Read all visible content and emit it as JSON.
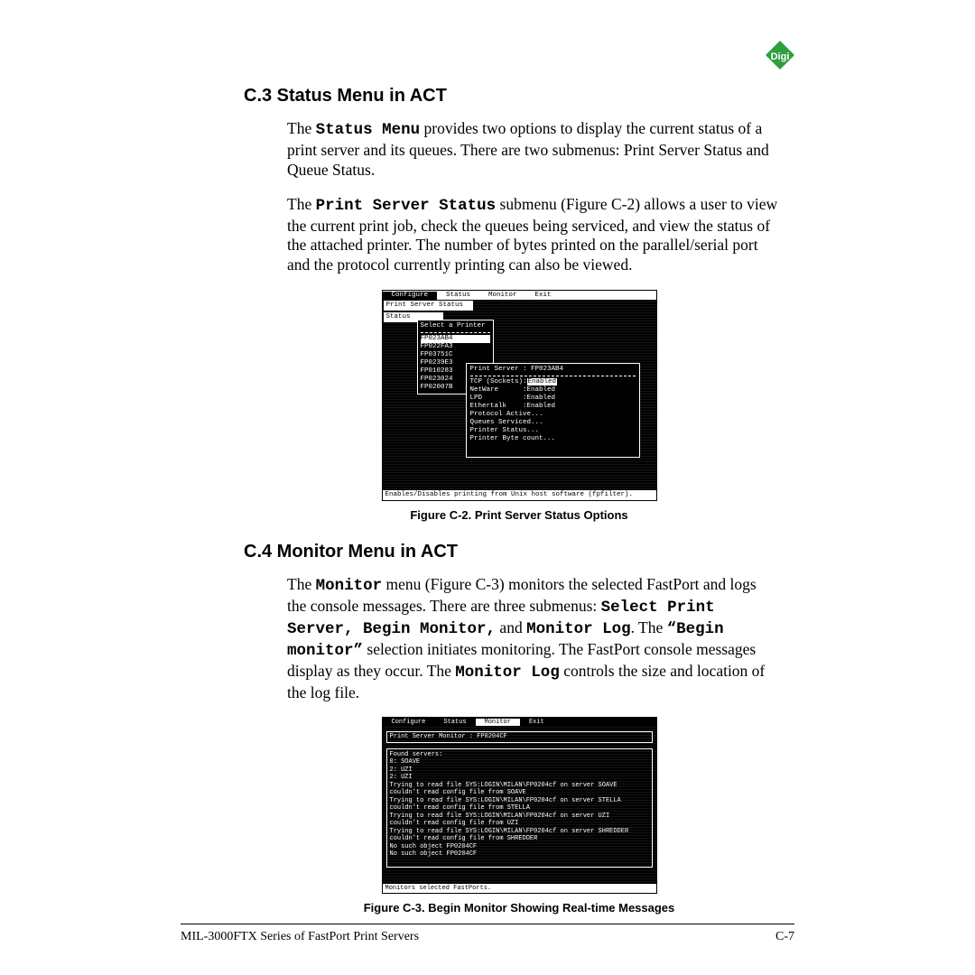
{
  "logo": {
    "label": "Digi"
  },
  "section_c3": {
    "heading": "C.3  Status Menu in ACT",
    "para1_pre": "The ",
    "para1_mono": "Status Menu",
    "para1_post": " provides two options to display the current status of a print server and its queues. There are two submenus: Print Server Status and Queue Status.",
    "para2_pre": "The ",
    "para2_mono": "Print Server Status",
    "para2_post": " submenu (Figure C-2) allows a user to view the current print job, check the queues being serviced, and view the status of the attached printer. The number of bytes printed on the parallel/serial port and the protocol currently printing can also be viewed."
  },
  "term1": {
    "menubar": [
      "Configure",
      "Status",
      "Monitor",
      "Exit"
    ],
    "drop1": "Print Server Status",
    "drop2": "Status",
    "select_label": "Select a Printer",
    "printers": [
      "FP023AB4",
      "FP022FA3",
      "FP03751C",
      "FP0239E3",
      "FP010283",
      "FP023024",
      "FP02007B"
    ],
    "main_title": "Print Server : FP023AB4",
    "rows": {
      "tcp": "TCP (Sockets):",
      "netware": "NetWare      :",
      "lpd": "LPD          :",
      "ethertalk": "Ethertalk    :",
      "proto": "Protocol Active...",
      "queues": "Queues Serviced...",
      "pstatus": "Printer Status...",
      "bytes": "Printer Byte count..."
    },
    "enabled": "Enabled",
    "statusbar": "Enables/Disables printing from Unix host software (fpfilter).",
    "caption": "Figure C-2. Print Server Status Options"
  },
  "section_c4": {
    "heading": "C.4  Monitor Menu in ACT",
    "p_pre": "The ",
    "p_m1": "Monitor",
    "p_mid1": " menu (Figure C-3) monitors the selected FastPort and logs the console messages. There are three submenus: ",
    "p_m2": "Select Print Server, Begin Monitor,",
    "p_mid2": " and ",
    "p_m3": "Monitor Log",
    "p_mid3": ". The ",
    "p_m4": "“Begin monitor”",
    "p_mid4": " selection initiates monitoring. The FastPort console messages display as they occur. The ",
    "p_m5": "Monitor Log",
    "p_post": " controls the size and location of the log file."
  },
  "term2": {
    "menubar": [
      "Configure",
      "Status",
      "Monitor",
      "Exit"
    ],
    "title": "Print Server Monitor : FP0204CF",
    "log": [
      "Found servers:",
      "0: SOAVE",
      "2: UZI",
      "2: UZI",
      "Trying to read file SYS:LOGIN\\MILAN\\FP0204cf on server SOAVE",
      "couldn't read config file from SOAVE",
      "Trying to read file SYS:LOGIN\\MILAN\\FP0204cf on server STELLA",
      "couldn't read config file from STELLA",
      "Trying to read file SYS:LOGIN\\MILAN\\FP0204cf on server UZI",
      "couldn't read config file from UZI",
      "Trying to read file SYS:LOGIN\\MILAN\\FP0204cf on server SHREDDER",
      "couldn't read config file from SHREDDER",
      "",
      "No such object FP0204CF",
      "No such object FP0204CF"
    ],
    "statusbar": "Monitors selected FastPorts.",
    "caption": "Figure C-3. Begin Monitor Showing Real-time Messages"
  },
  "footer": {
    "left": "MIL-3000FTX Series of FastPort Print Servers",
    "right": "C-7"
  }
}
